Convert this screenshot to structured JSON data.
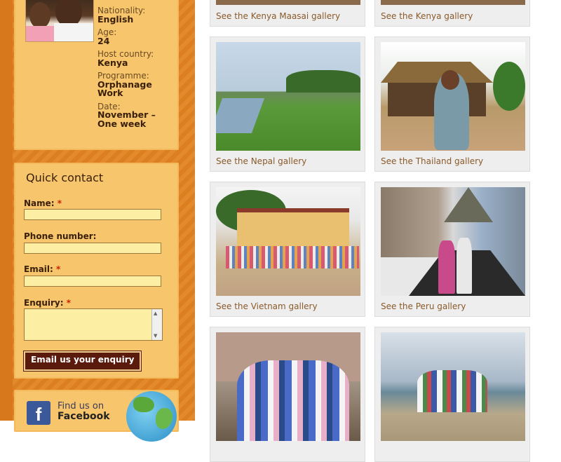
{
  "profile": {
    "nationality_label": "Nationality:",
    "nationality_value": "English",
    "age_label": "Age:",
    "age_value": "24",
    "host_label": "Host country:",
    "host_value": "Kenya",
    "programme_label": "Programme:",
    "programme_value": "Orphanage Work",
    "date_label": "Date:",
    "date_value": "November – One week"
  },
  "quick_contact": {
    "title": "Quick contact",
    "name_label": "Name:",
    "phone_label": "Phone number:",
    "email_label": "Email:",
    "enquiry_label": "Enquiry:",
    "required_mark": "*",
    "submit_label": "Email us your enquiry"
  },
  "facebook": {
    "logo": "f",
    "line1": "Find us on",
    "line2": "Facebook"
  },
  "galleries": {
    "top": [
      "See the Kenya Maasai gallery",
      "See the Kenya gallery"
    ],
    "items": [
      {
        "caption": "See the Nepal gallery"
      },
      {
        "caption": "See the Thailand gallery"
      },
      {
        "caption": "See the Vietnam gallery"
      },
      {
        "caption": "See the Peru gallery"
      },
      {
        "caption": ""
      },
      {
        "caption": ""
      }
    ]
  },
  "colors": {
    "sidebar": "#e38a2c",
    "panel": "#f7c56c",
    "input_bg": "#fcefa4",
    "button_bg": "#5a1a0c",
    "caption": "#8a5a2a"
  }
}
